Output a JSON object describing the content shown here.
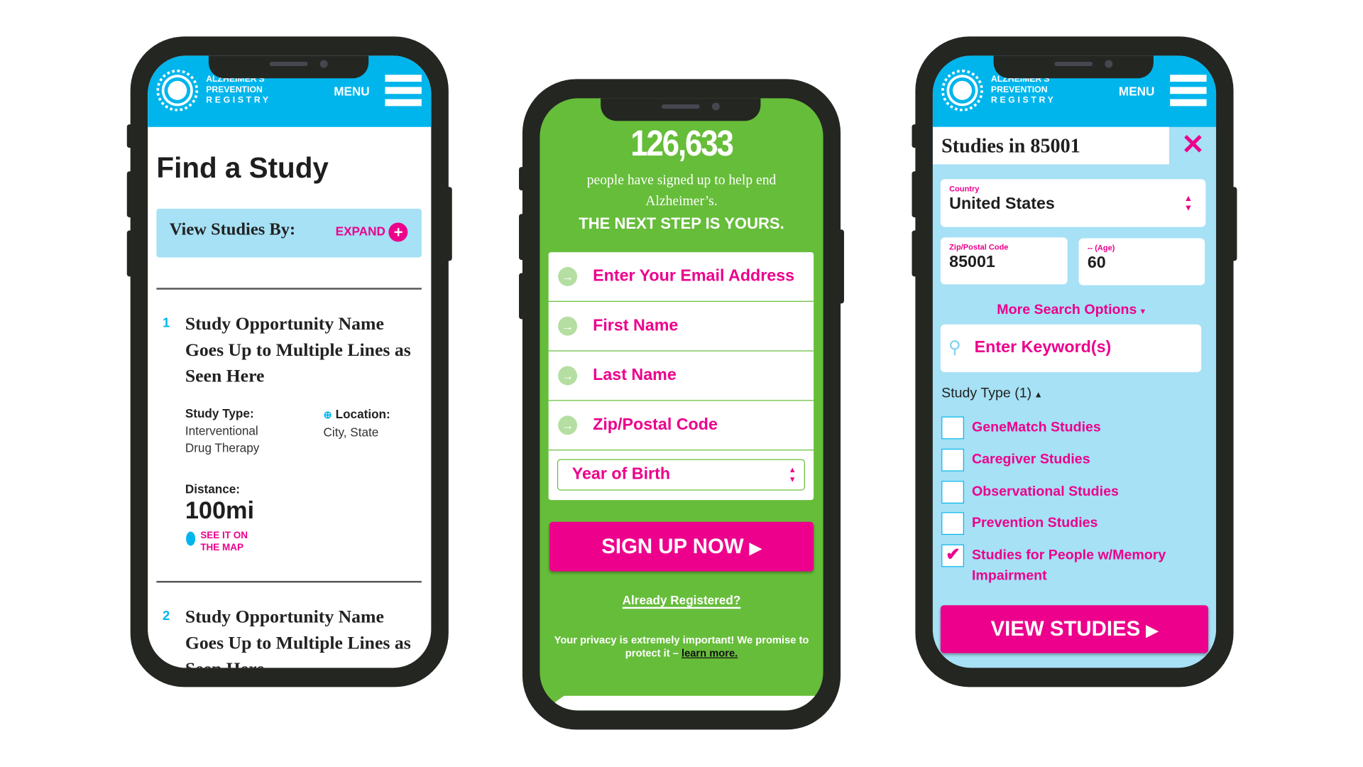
{
  "brand": {
    "line1": "ALZHEIMER'S",
    "line2": "PREVENTION",
    "line3": "REGISTRY",
    "menu_label": "MENU",
    "colors": {
      "blue": "#00b5ec",
      "light_blue": "#a6e1f5",
      "pink": "#ec008c",
      "green": "#66bd3a"
    }
  },
  "find_study": {
    "title": "Find a Study",
    "view_by_label": "View Studies By:",
    "expand_label": "EXPAND",
    "studies": [
      {
        "number": "1",
        "title": "Study Opportunity Name Goes Up to Multiple Lines as Seen Here",
        "type_label": "Study Type:",
        "type_line1": "Interventional",
        "type_line2": "Drug Therapy",
        "location_label": "Location:",
        "location": "City, State",
        "distance_label": "Distance:",
        "distance": "100mi",
        "map_line1": "SEE IT ON",
        "map_line2": "THE MAP"
      },
      {
        "number": "2",
        "title": "Study Opportunity Name Goes Up to Multiple Lines as Seen Here"
      }
    ]
  },
  "signup": {
    "count": "126,633",
    "subtitle_line1": "people have signed up to help end",
    "subtitle_line2": "Alzheimer’s.",
    "headline": "THE NEXT STEP IS YOURS.",
    "fields": [
      {
        "placeholder": "Enter Your Email Address"
      },
      {
        "placeholder": "First Name"
      },
      {
        "placeholder": "Last Name"
      },
      {
        "placeholder": "Zip/Postal Code"
      }
    ],
    "year_select": "Year of Birth",
    "submit_label": "SIGN UP NOW",
    "already_registered": "Already Registered?",
    "privacy_text_line1": "Your privacy is extremely important! We promise to",
    "privacy_text_line2": "protect it –",
    "learn_more": "learn more."
  },
  "search": {
    "title": "Studies in 85001",
    "country_label": "Country",
    "country_value": "United States",
    "zip_label": "Zip/Postal Code",
    "zip_value": "85001",
    "age_label": "-- (Age)",
    "age_value": "60",
    "more_options": "More Search Options",
    "keyword_placeholder": "Enter Keyword(s)",
    "study_type_label": "Study Type (1)",
    "study_types": [
      {
        "label": "GeneMatch Studies",
        "checked": false
      },
      {
        "label": "Caregiver Studies",
        "checked": false
      },
      {
        "label": "Observational Studies",
        "checked": false
      },
      {
        "label": "Prevention Studies",
        "checked": false
      },
      {
        "label": "Studies for People w/Memory Impairment",
        "checked": true
      }
    ],
    "view_label": "VIEW STUDIES"
  }
}
